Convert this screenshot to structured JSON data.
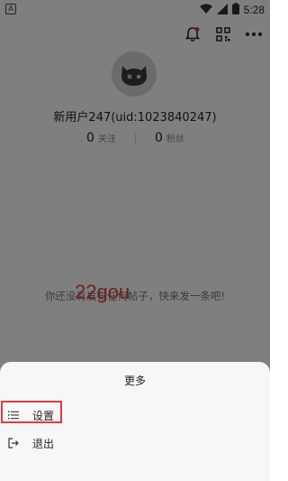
{
  "status_bar": {
    "left_badge": "A",
    "time": "5:28",
    "icons": [
      "wifi-icon",
      "signal-icon",
      "battery-icon"
    ]
  },
  "header_icons": [
    "bell-icon",
    "qr-code-icon",
    "more-icon"
  ],
  "profile": {
    "username": "新用户247(uid:1023840247)",
    "following_count": "0",
    "following_label": "关注",
    "followers_count": "0",
    "followers_label": "粉丝"
  },
  "empty_state": {
    "text": "你还没有发布任何帖子，快来发一条吧!",
    "watermark": "22gou"
  },
  "sheet": {
    "title": "更多",
    "items": [
      {
        "icon": "list-icon",
        "label": "设置"
      },
      {
        "icon": "logout-icon",
        "label": "退出"
      }
    ]
  },
  "colors": {
    "overlay": "#00000080",
    "sheet_bg": "#f7f7f7",
    "highlight": "#e23b3b",
    "notification_dot": "#e53935"
  }
}
